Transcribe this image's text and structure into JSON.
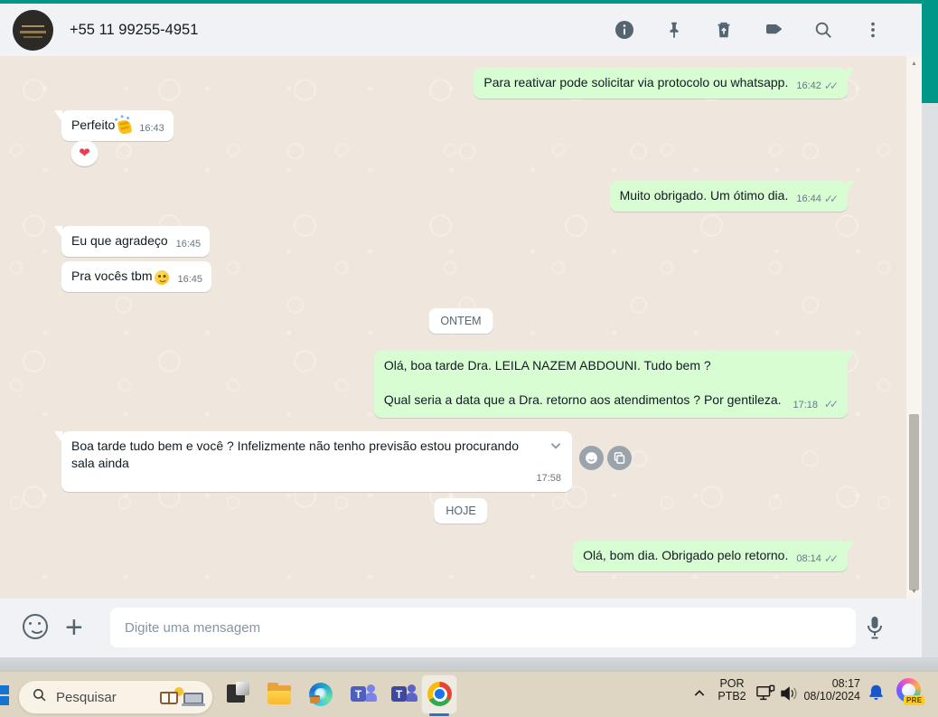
{
  "colors": {
    "accent_teal": "#009688",
    "bubble_out": "#d9fdd3",
    "bubble_in": "#ffffff",
    "chat_bg": "#efe7dd",
    "taskbar_bg": "#ded6c3"
  },
  "header": {
    "phone": "+55 11 99255-4951",
    "icons": [
      "info",
      "pin",
      "delete",
      "label",
      "search",
      "menu"
    ]
  },
  "chat": {
    "dividers": [
      {
        "label": "ONTEM"
      },
      {
        "label": "HOJE"
      }
    ],
    "messages": [
      {
        "dir": "out",
        "text": "Para reativar pode solicitar via protocolo ou whatsapp.",
        "time": "16:42",
        "ticks": "✓✓"
      },
      {
        "dir": "in",
        "text": "Perfeito",
        "emoji": "clap 👏",
        "time": "16:43",
        "reaction": "red-heart ❤",
        "reaction_glyph": "❤"
      },
      {
        "dir": "out",
        "text": "Muito obrigado. Um ótimo dia.",
        "time": "16:44",
        "ticks": "✓✓"
      },
      {
        "dir": "in",
        "text": "Eu que agradeço",
        "time": "16:45"
      },
      {
        "dir": "in",
        "text": "Pra vocês tbm",
        "emoji": "smiling-face 😊",
        "time": "16:45"
      },
      {
        "dir": "out",
        "lines": [
          "Olá, boa tarde Dra. LEILA NAZEM ABDOUNI. Tudo bem ?",
          "Qual seria a data que a Dra. retorno aos atendimentos ? Por gentileza."
        ],
        "time": "17:18",
        "ticks": "✓✓"
      },
      {
        "dir": "in",
        "text": "Boa tarde tudo bem e você ? Infelizmente não tenho previsão estou procurando sala ainda",
        "time": "17:58",
        "hover_actions": [
          "react-emoji",
          "copy"
        ]
      },
      {
        "dir": "out",
        "text": "Olá, bom dia. Obrigado pelo retorno.",
        "time": "08:14",
        "ticks": "✓✓"
      }
    ]
  },
  "composer": {
    "placeholder": "Digite uma mensagem",
    "icons": [
      "emoji",
      "plus",
      "microphone"
    ]
  },
  "taskbar": {
    "search_label": "Pesquisar",
    "apps": [
      "snip-squares",
      "file-explorer",
      "edge",
      "teams-classic",
      "teams",
      "chrome-active"
    ],
    "tray": {
      "lang_line1": "POR",
      "lang_line2": "PTB2",
      "time": "08:17",
      "date": "08/10/2024",
      "copilot_badge": "PRE"
    }
  }
}
